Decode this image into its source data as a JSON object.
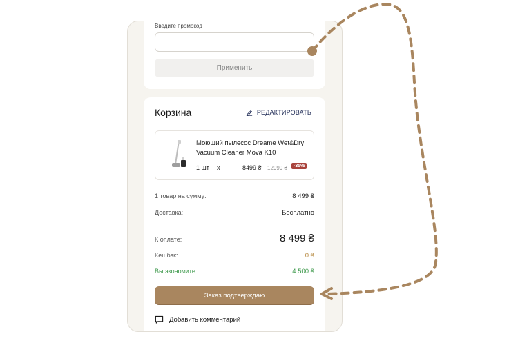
{
  "promo": {
    "label": "Введите промокод",
    "input_value": "",
    "apply_label": "Применить"
  },
  "cart": {
    "title": "Корзина",
    "edit_label": "РЕДАКТИРОВАТЬ",
    "product": {
      "name": "Моющий пылесос Dreame Wet&Dry Vacuum Cleaner Mova K10",
      "qty": "1 шт",
      "times": "х",
      "price": "8499 ₴",
      "old_price": "12999 ₴",
      "discount": "-35%"
    },
    "summary": {
      "items_label": "1 товар на сумму:",
      "items_value": "8 499 ₴",
      "delivery_label": "Доставка:",
      "delivery_value": "Бесплатно",
      "total_label": "К оплате:",
      "total_value": "8 499 ₴",
      "cashback_label": "Кешбэк:",
      "cashback_value": "0 ₴",
      "save_label": "Вы экономите:",
      "save_value": "4 500 ₴"
    },
    "confirm_label": "Заказ подтверждаю",
    "comment_label": "Добавить комментарий"
  },
  "colors": {
    "accent": "#a9865f",
    "discount_badge": "#a9433c",
    "savings": "#3f9a4d",
    "cashback": "#b6883e",
    "edit_link": "#1e2a55"
  },
  "icons": {
    "edit": "pencil-icon",
    "comment": "comment-icon",
    "product": "vacuum-cleaner-image"
  }
}
